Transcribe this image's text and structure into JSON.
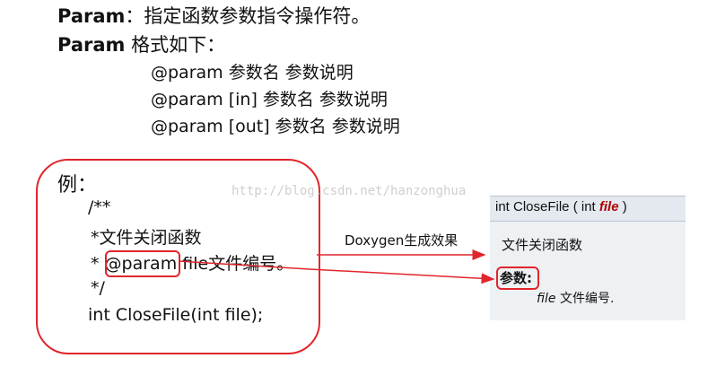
{
  "intro": {
    "param_word": "Param",
    "line1_rest": "：指定函数参数指令操作符。",
    "line2_rest": " 格式如下："
  },
  "formats": [
    "@param 参数名  参数说明",
    "@param [in] 参数名 参数说明",
    "@param [out] 参数名 参数说明"
  ],
  "example": {
    "title": "例：",
    "code_lines": [
      "/**",
      "*文件关闭函数",
      "* ",
      "*/",
      "int CloseFile(int file);"
    ],
    "param_tag": "@param",
    "param_rest": "  file文件编号。"
  },
  "watermark": "http://blog.csdn.net/hanzonghua",
  "arrow_label": "Doxygen生成效果",
  "doc_output": {
    "signature_prefix": "int CloseFile ( int ",
    "signature_param": "file",
    "signature_suffix": " )",
    "description": "文件关闭函数",
    "params_heading": "参数:",
    "param_name": "file",
    "param_desc": " 文件编号."
  },
  "colors": {
    "highlight": "#e0262c"
  }
}
